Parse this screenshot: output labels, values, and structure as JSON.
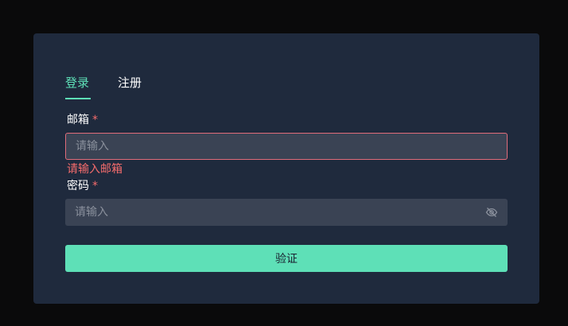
{
  "tabs": [
    {
      "label": "登录",
      "active": true
    },
    {
      "label": "注册",
      "active": false
    }
  ],
  "form": {
    "email": {
      "label": "邮箱",
      "required_mark": "*",
      "placeholder": "请输入",
      "value": "",
      "error": "请输入邮箱"
    },
    "password": {
      "label": "密码",
      "required_mark": "*",
      "placeholder": "请输入",
      "value": "",
      "toggle_icon": "eye-off-icon"
    },
    "submit_label": "验证"
  },
  "colors": {
    "accent": "#5ee0b7",
    "error": "#f56c6c",
    "card": "#1f2a3d",
    "input": "#3a4354",
    "background": "#0a0a0b"
  }
}
